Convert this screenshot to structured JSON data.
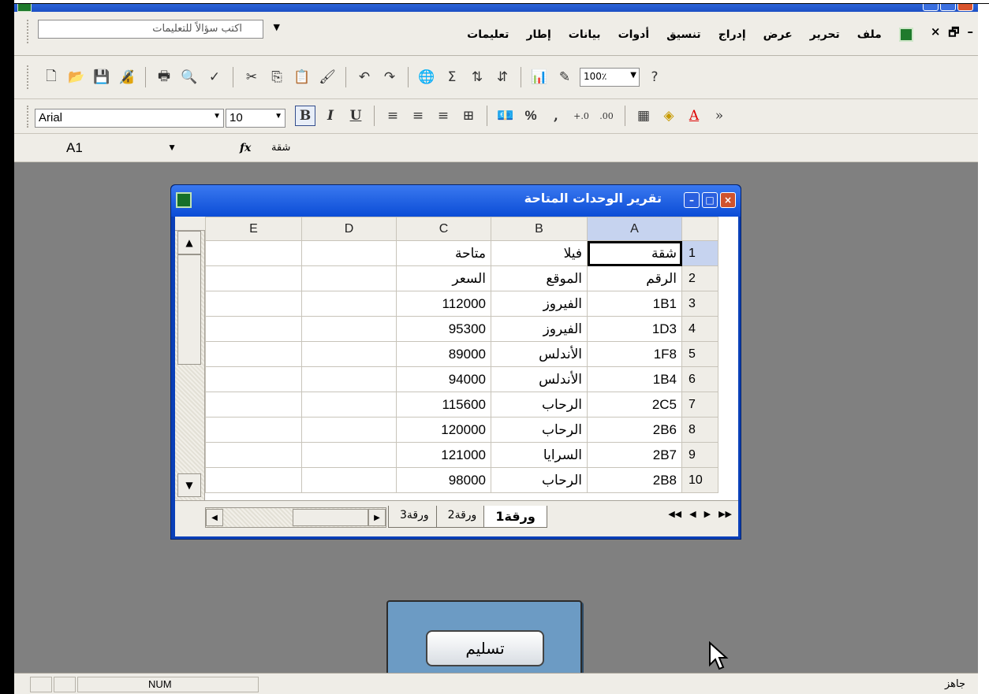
{
  "menubar": {
    "doc_controls": [
      "×",
      "🗗",
      "–"
    ],
    "items": [
      "ملف",
      "تحرير",
      "عرض",
      "إدراج",
      "تنسيق",
      "أدوات",
      "بيانات",
      "إطار",
      "تعليمات"
    ],
    "help_placeholder": "اكتب سؤالاً للتعليمات"
  },
  "standard_toolbar": {
    "icons": [
      "new-icon",
      "open-icon",
      "save-icon",
      "permission-icon",
      "print-icon",
      "print-preview-icon",
      "spelling-icon",
      "cut-icon",
      "copy-icon",
      "paste-icon",
      "format-painter-icon",
      "undo-icon",
      "redo-icon",
      "hyperlink-icon",
      "autosum-icon",
      "sort-ascending-icon",
      "sort-descending-icon",
      "chart-wizard-icon",
      "drawing-icon"
    ],
    "zoom": "100٪"
  },
  "formatting_toolbar": {
    "font": "Arial",
    "size": "10",
    "bold": "B",
    "italic": "I",
    "underline": "U",
    "percent": "%",
    "comma": ",",
    "more": "»"
  },
  "formula_bar": {
    "name_box": "A1",
    "fx": "fx",
    "value": "شقة"
  },
  "workbook": {
    "title": "تقرير الوحدات المتاحة",
    "columns": [
      "A",
      "B",
      "C",
      "D",
      "E"
    ],
    "rows": [
      {
        "n": "1",
        "a": "شقة",
        "b": "فيلا",
        "c": "متاحة"
      },
      {
        "n": "2",
        "a": "الرقم",
        "b": "الموقع",
        "c": "السعر"
      },
      {
        "n": "3",
        "a": "1B1",
        "b": "الفيروز",
        "c": "112000"
      },
      {
        "n": "4",
        "a": "1D3",
        "b": "الفيروز",
        "c": "95300"
      },
      {
        "n": "5",
        "a": "1F8",
        "b": "الأندلس",
        "c": "89000"
      },
      {
        "n": "6",
        "a": "1B4",
        "b": "الأندلس",
        "c": "94000"
      },
      {
        "n": "7",
        "a": "2C5",
        "b": "الرحاب",
        "c": "115600"
      },
      {
        "n": "8",
        "a": "2B6",
        "b": "الرحاب",
        "c": "120000"
      },
      {
        "n": "9",
        "a": "2B7",
        "b": "السرايا",
        "c": "121000"
      },
      {
        "n": "10",
        "a": "2B8",
        "b": "الرحاب",
        "c": "98000"
      }
    ],
    "sheet_tabs": [
      "ورقة1",
      "ورقة2",
      "ورقة3"
    ]
  },
  "submit_button": "تسليم",
  "statusbar": {
    "ready": "جاهز",
    "num": "NUM"
  },
  "colors": {
    "titlebar": "#0b4cd6",
    "panel": "#6c9bc4",
    "workspace": "#808080"
  }
}
